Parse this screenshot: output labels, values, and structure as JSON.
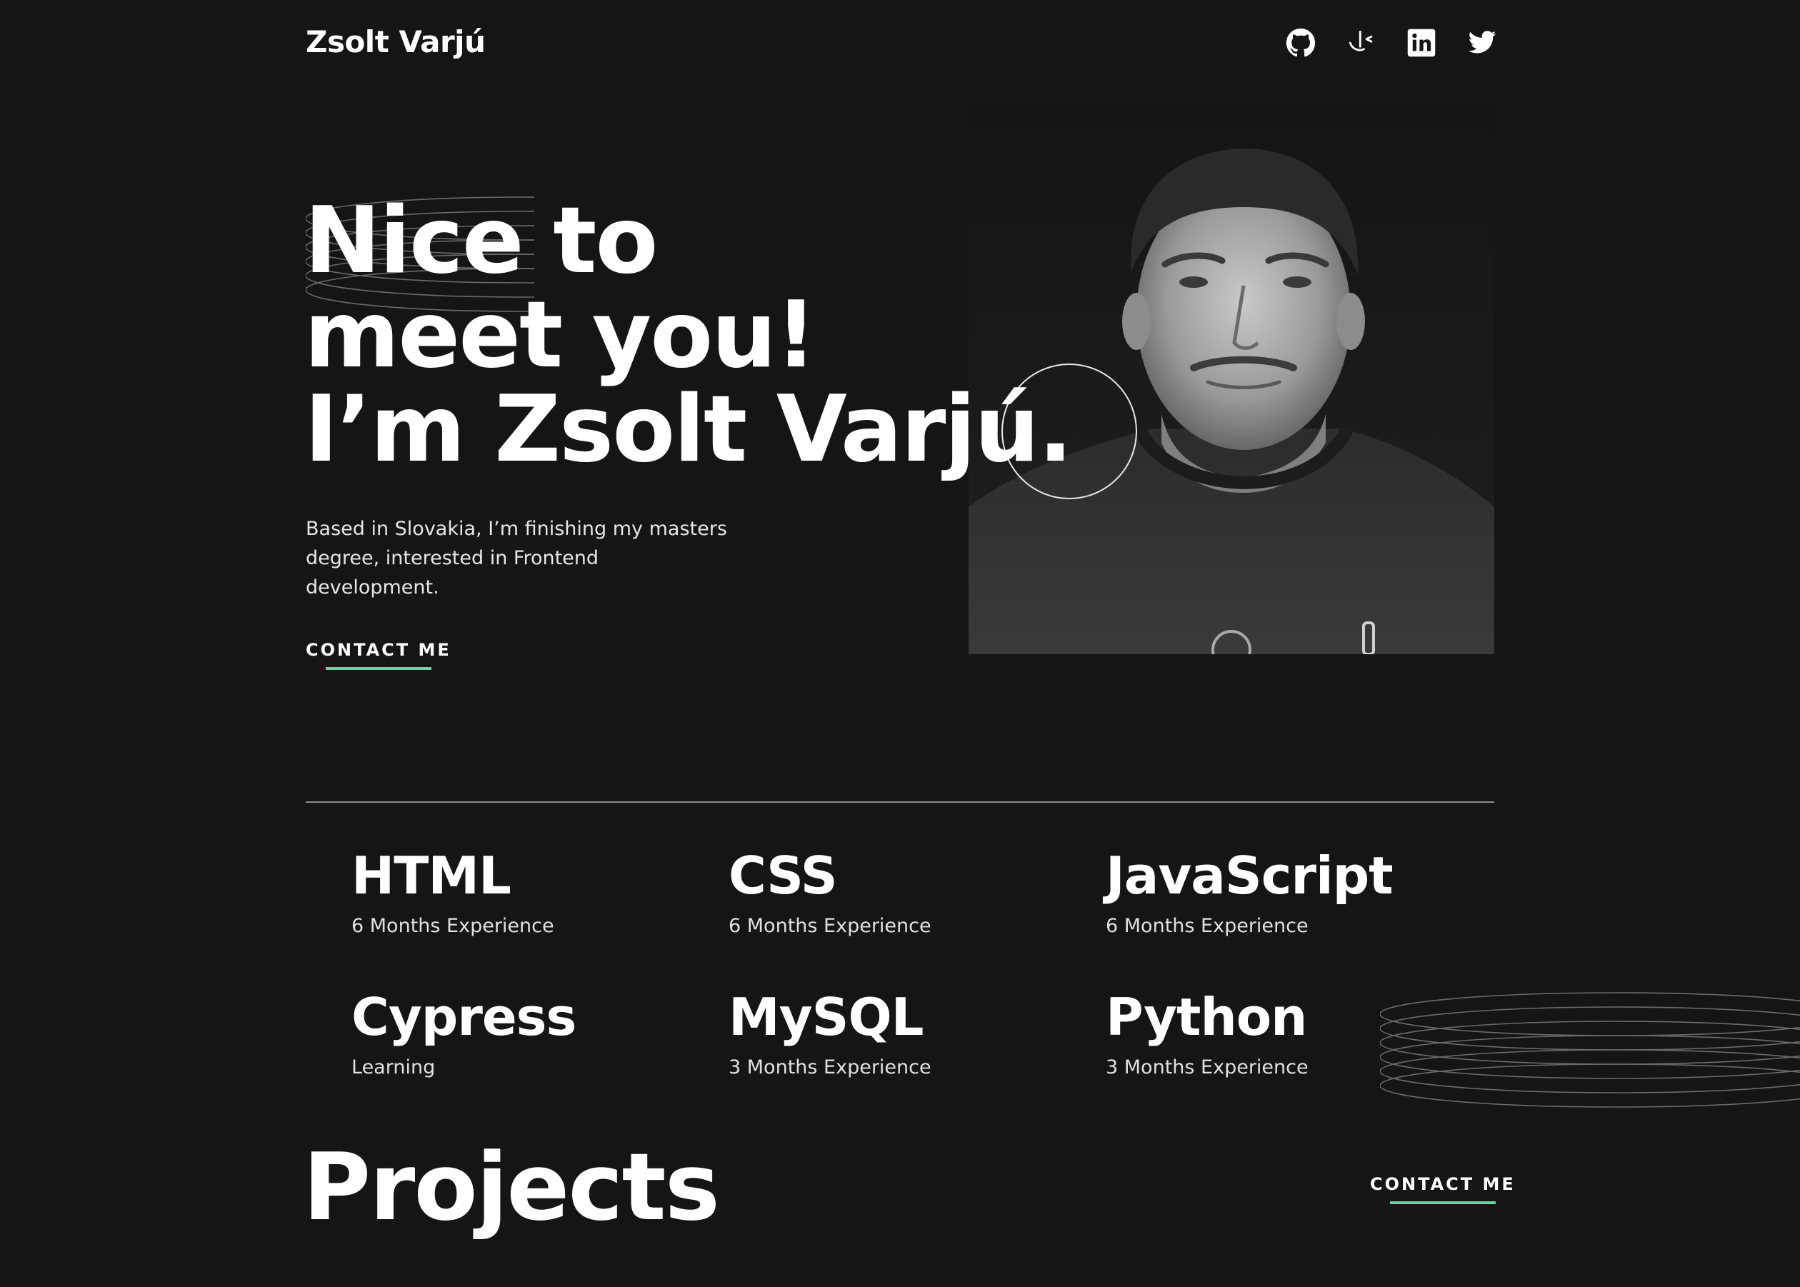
{
  "header": {
    "logo": "Zsolt Varjú",
    "socials": [
      {
        "name": "github-icon"
      },
      {
        "name": "frontend-mentor-icon"
      },
      {
        "name": "linkedin-icon"
      },
      {
        "name": "twitter-icon"
      }
    ]
  },
  "hero": {
    "title_line1": "Nice to",
    "title_line2": "meet you!",
    "title_prefix": "I’m ",
    "title_name": "Zsolt Varjú",
    "title_suffix": ".",
    "intro": "Based in Slovakia, I’m finishing my masters degree, interested in Frontend development.",
    "contact_label": "CONTACT ME"
  },
  "skills": [
    {
      "name": "HTML",
      "experience": "6 Months Experience"
    },
    {
      "name": "CSS",
      "experience": "6 Months Experience"
    },
    {
      "name": "JavaScript",
      "experience": "6 Months Experience"
    },
    {
      "name": "Cypress",
      "experience": "Learning"
    },
    {
      "name": "MySQL",
      "experience": "3 Months Experience"
    },
    {
      "name": "Python",
      "experience": "3 Months Experience"
    }
  ],
  "projects": {
    "title": "Projects",
    "contact_label": "CONTACT ME"
  },
  "colors": {
    "background": "#151515",
    "accent": "#4ee1a0",
    "text": "#ffffff"
  }
}
